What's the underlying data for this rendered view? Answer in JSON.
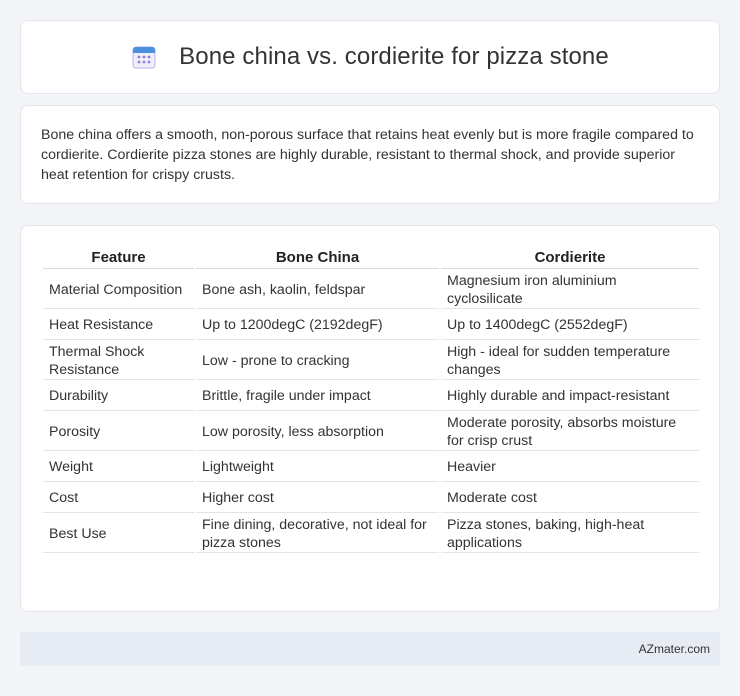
{
  "header": {
    "title": "Bone china vs. cordierite for pizza stone",
    "icon": "calendar-icon",
    "icon_color": "#8a7fd6",
    "icon_accent": "#4a8fe0"
  },
  "summary": {
    "text": "Bone china offers a smooth, non-porous surface that retains heat evenly but is more fragile compared to cordierite. Cordierite pizza stones are highly durable, resistant to thermal shock, and provide superior heat retention for crispy crusts."
  },
  "table": {
    "headers": [
      "Feature",
      "Bone China",
      "Cordierite"
    ],
    "rows": [
      [
        "Material Composition",
        "Bone ash, kaolin, feldspar",
        "Magnesium iron aluminium cyclosilicate"
      ],
      [
        "Heat Resistance",
        "Up to 1200degC (2192degF)",
        "Up to 1400degC (2552degF)"
      ],
      [
        "Thermal Shock Resistance",
        "Low - prone to cracking",
        "High - ideal for sudden temperature changes"
      ],
      [
        "Durability",
        "Brittle, fragile under impact",
        "Highly durable and impact-resistant"
      ],
      [
        "Porosity",
        "Low porosity, less absorption",
        "Moderate porosity, absorbs moisture for crisp crust"
      ],
      [
        "Weight",
        "Lightweight",
        "Heavier"
      ],
      [
        "Cost",
        "Higher cost",
        "Moderate cost"
      ],
      [
        "Best Use",
        "Fine dining, decorative, not ideal for pizza stones",
        "Pizza stones, baking, high-heat applications"
      ]
    ]
  },
  "footer": {
    "brand": "AZmater.com"
  }
}
